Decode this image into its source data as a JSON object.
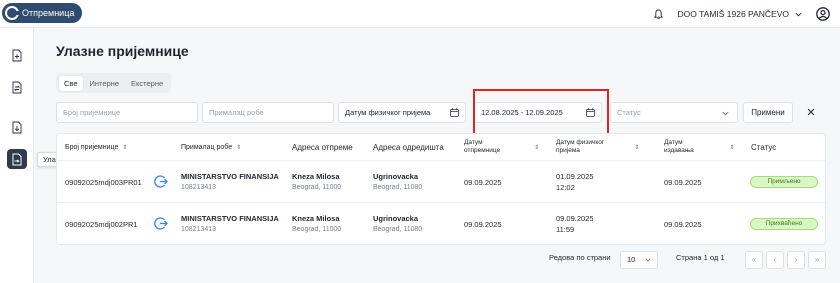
{
  "app": {
    "logo_text": "Отпремница"
  },
  "header": {
    "company": "DOO TAMIŠ 1926 PANČEVO"
  },
  "sidebar": {
    "tooltip": "Улазне пријемнице"
  },
  "page": {
    "title": "Улазне пријемнице"
  },
  "tabs": [
    {
      "label": "Све",
      "active": true
    },
    {
      "label": "Интерне",
      "active": false
    },
    {
      "label": "Екстерне",
      "active": false
    }
  ],
  "filters": {
    "receipt_number_placeholder": "Број пријемнице",
    "recipient_placeholder": "Прималац робе",
    "physical_date_label": "Датум физичког пријема",
    "date_range_value": "12.08.2025 - 12.09.2025",
    "status_placeholder": "Статус",
    "apply_label": "Примени",
    "clear_label": "✕"
  },
  "table": {
    "columns": {
      "receipt": "Број пријемнице",
      "recipient": "Прималац робе",
      "origin": "Адреса отпреме",
      "destination": "Адреса одредишта",
      "shipment_date": [
        "Датум",
        "отпремнице"
      ],
      "physical_date": [
        "Датум физичког",
        "пријема"
      ],
      "issue_date": [
        "Датум",
        "издавања"
      ],
      "status": "Статус"
    },
    "rows": [
      {
        "number": "09092025mdj003PR01",
        "recipient_name": "MINISTARSTVO FINANSIJA",
        "recipient_id": "108213413",
        "origin_street": "Kneza Milosa",
        "origin_city": "Beograd, 11000",
        "dest_street": "Ugrinovacka",
        "dest_city": "Beograd, 11080",
        "shipment_date": "09.09.2025",
        "physical_date": "01.09.2025",
        "physical_time": "12:02",
        "issue_date": "09.09.2025",
        "status": "Примљено"
      },
      {
        "number": "09092025mdj002PR1",
        "recipient_name": "MINISTARSTVO FINANSIJA",
        "recipient_id": "108213413",
        "origin_street": "Kneza Milosa",
        "origin_city": "Beograd, 11000",
        "dest_street": "Ugrinovacka",
        "dest_city": "Beograd, 11080",
        "shipment_date": "09.09.2025",
        "physical_date": "09.09.2025",
        "physical_time": "11:59",
        "issue_date": "09.09.2025",
        "status": "Прихваћено"
      }
    ]
  },
  "pagination": {
    "rows_per_page_label": "Редова по страни",
    "rows_per_page_value": "10",
    "page_info": "Страна 1 од 1",
    "first": "«",
    "prev": "‹",
    "next": "›",
    "last": "»"
  }
}
